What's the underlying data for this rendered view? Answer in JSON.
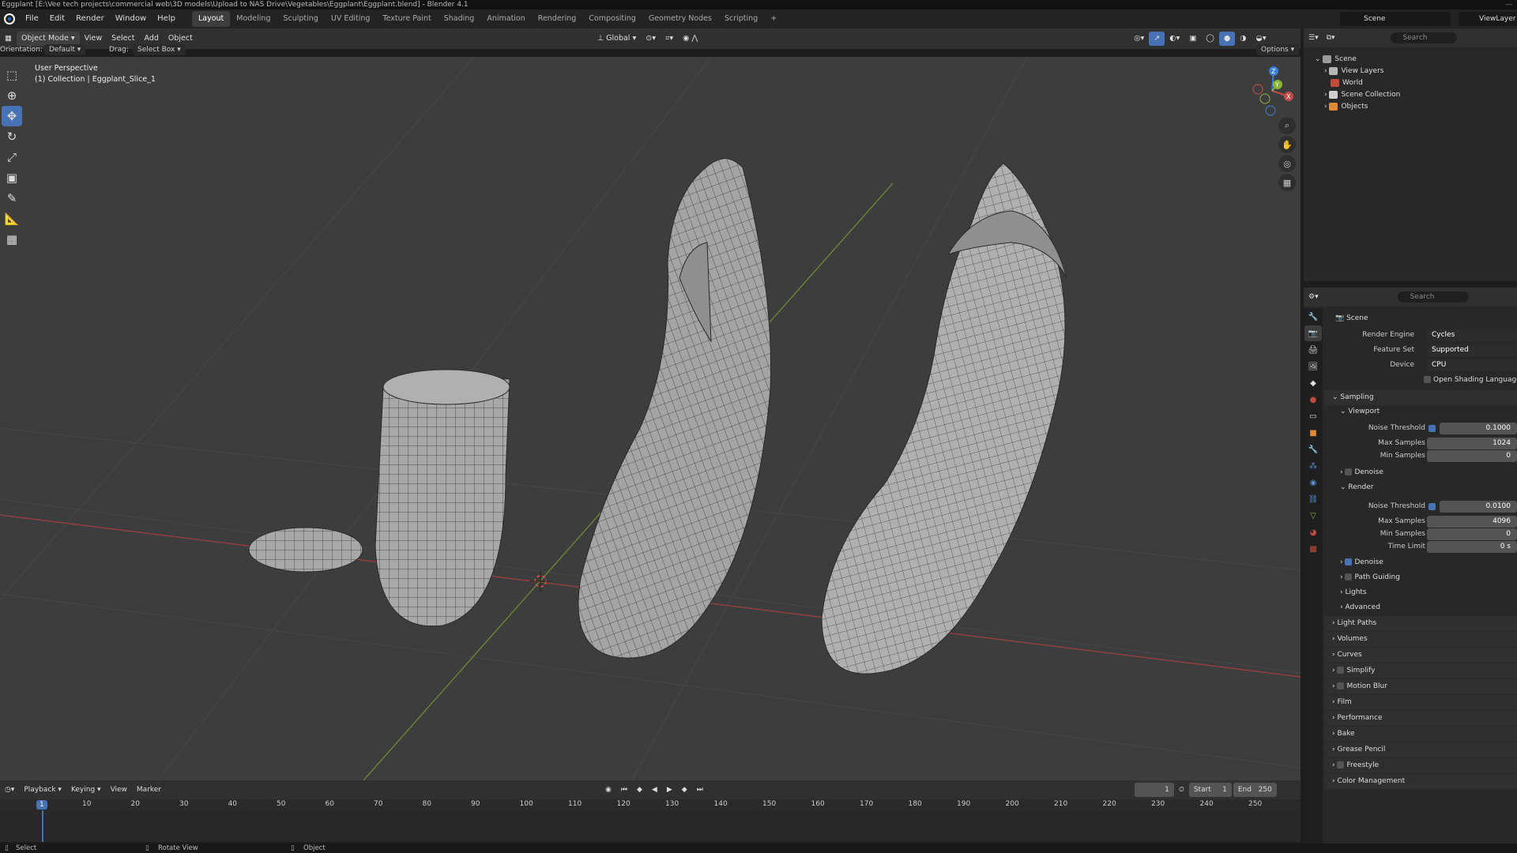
{
  "window": {
    "title": "Eggplant [E:\\Vee tech projects\\commercial web\\3D models\\Upload to NAS Drive\\Vegetables\\Eggplant\\Eggplant.blend] - Blender 4.1",
    "controls": "—"
  },
  "menu": [
    "File",
    "Edit",
    "Render",
    "Window",
    "Help"
  ],
  "workspaces": [
    {
      "label": "Layout",
      "active": true
    },
    {
      "label": "Modeling",
      "active": false
    },
    {
      "label": "Sculpting",
      "active": false
    },
    {
      "label": "UV Editing",
      "active": false
    },
    {
      "label": "Texture Paint",
      "active": false
    },
    {
      "label": "Shading",
      "active": false
    },
    {
      "label": "Animation",
      "active": false
    },
    {
      "label": "Rendering",
      "active": false
    },
    {
      "label": "Compositing",
      "active": false
    },
    {
      "label": "Geometry Nodes",
      "active": false
    },
    {
      "label": "Scripting",
      "active": false
    }
  ],
  "workspace_add": "+",
  "scene_selector": "Scene",
  "viewlayer_selector": "ViewLayer",
  "viewport_header": {
    "mode": "Object Mode",
    "menus": [
      "View",
      "Select",
      "Add",
      "Object"
    ],
    "transform_orientation": "Global",
    "options": "Options"
  },
  "viewport_header2": {
    "orientation_label": "Orientation:",
    "orientation_value": "Default",
    "drag_label": "Drag:",
    "drag_value": "Select Box"
  },
  "viewport_info": {
    "line1": "User Perspective",
    "line2": "(1) Collection | Eggplant_Slice_1"
  },
  "gizmo": {
    "z": "Z",
    "y": "Y",
    "x": "X"
  },
  "toolbar_tools": [
    "select-box",
    "cursor",
    "move",
    "rotate",
    "scale",
    "transform",
    "annotate",
    "measure",
    "add-cube"
  ],
  "outliner": {
    "search_placeholder": "Search",
    "items": [
      {
        "label": "Scene",
        "indent": 0,
        "icon_color": "#9a9a9a"
      },
      {
        "label": "View Layers",
        "indent": 1,
        "icon_color": "#b6b6b6"
      },
      {
        "label": "World",
        "indent": 1,
        "icon_color": "#c24b3c"
      },
      {
        "label": "Scene Collection",
        "indent": 1,
        "icon_color": "#cfcfcf"
      },
      {
        "label": "Objects",
        "indent": 1,
        "icon_color": "#e08a35"
      }
    ]
  },
  "properties": {
    "search_placeholder": "Search",
    "context": "Scene",
    "render_engine_label": "Render Engine",
    "render_engine": "Cycles",
    "feature_set_label": "Feature Set",
    "feature_set": "Supported",
    "device_label": "Device",
    "device": "CPU",
    "osl_label": "Open Shading Language",
    "sampling": "Sampling",
    "viewport": "Viewport",
    "vp_noise_label": "Noise Threshold",
    "vp_noise": "0.1000",
    "vp_max_label": "Max Samples",
    "vp_max": "1024",
    "vp_min_label": "Min Samples",
    "vp_min": "0",
    "vp_denoise": "Denoise",
    "render": "Render",
    "r_noise_label": "Noise Threshold",
    "r_noise": "0.0100",
    "r_max_label": "Max Samples",
    "r_max": "4096",
    "r_min_label": "Min Samples",
    "r_min": "0",
    "r_time_label": "Time Limit",
    "r_time": "0 s",
    "r_denoise": "Denoise",
    "path_guiding": "Path Guiding",
    "lights": "Lights",
    "advanced": "Advanced",
    "panels": [
      "Light Paths",
      "Volumes",
      "Curves",
      "Simplify",
      "Motion Blur",
      "Film",
      "Performance",
      "Bake",
      "Grease Pencil",
      "Freestyle",
      "Color Management"
    ]
  },
  "timeline": {
    "menus": [
      "Playback",
      "Keying",
      "View",
      "Marker"
    ],
    "current_frame": "1",
    "start_label": "Start",
    "start": "1",
    "end_label": "End",
    "end": "250",
    "ruler": [
      "10",
      "20",
      "30",
      "40",
      "50",
      "60",
      "70",
      "80",
      "90",
      "100",
      "110",
      "120",
      "130",
      "140",
      "150",
      "160",
      "170",
      "180",
      "190",
      "200",
      "210",
      "220",
      "230",
      "240",
      "250"
    ],
    "playhead": "1"
  },
  "statusbar": {
    "select": "Select",
    "rotate": "Rotate View",
    "object": "Object"
  },
  "colors": {
    "accent": "#4772b3",
    "x_axis": "#c44a4a",
    "y_axis": "#8ab33a",
    "z_axis": "#3b7fd4"
  }
}
